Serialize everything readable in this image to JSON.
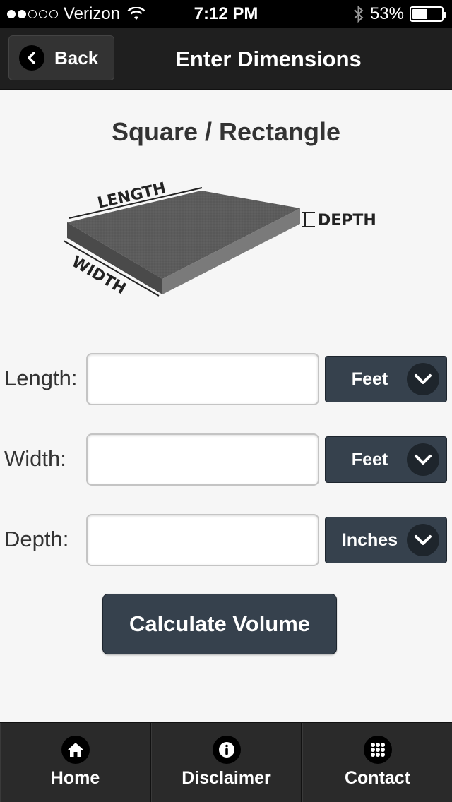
{
  "status_bar": {
    "carrier": "Verizon",
    "signal_bars_filled": 2,
    "signal_bars_total": 5,
    "time": "7:12 PM",
    "battery": "53%",
    "battery_level": 0.53
  },
  "header": {
    "back_label": "Back",
    "title": "Enter Dimensions"
  },
  "main": {
    "title": "Square / Rectangle",
    "diagram_labels": {
      "length": "LENGTH",
      "width": "WIDTH",
      "depth": "DEPTH"
    },
    "fields": [
      {
        "label": "Length:",
        "value": "",
        "unit": "Feet"
      },
      {
        "label": "Width:",
        "value": "",
        "unit": "Feet"
      },
      {
        "label": "Depth:",
        "value": "",
        "unit": "Inches"
      }
    ],
    "calculate_label": "Calculate Volume"
  },
  "bottom_nav": {
    "items": [
      {
        "label": "Home",
        "icon": "home-icon"
      },
      {
        "label": "Disclaimer",
        "icon": "info-icon"
      },
      {
        "label": "Contact",
        "icon": "grid-icon"
      }
    ]
  },
  "colors": {
    "header_bg": "#1f1f1f",
    "button_bg": "#36414d",
    "page_bg": "#f6f6f6"
  }
}
